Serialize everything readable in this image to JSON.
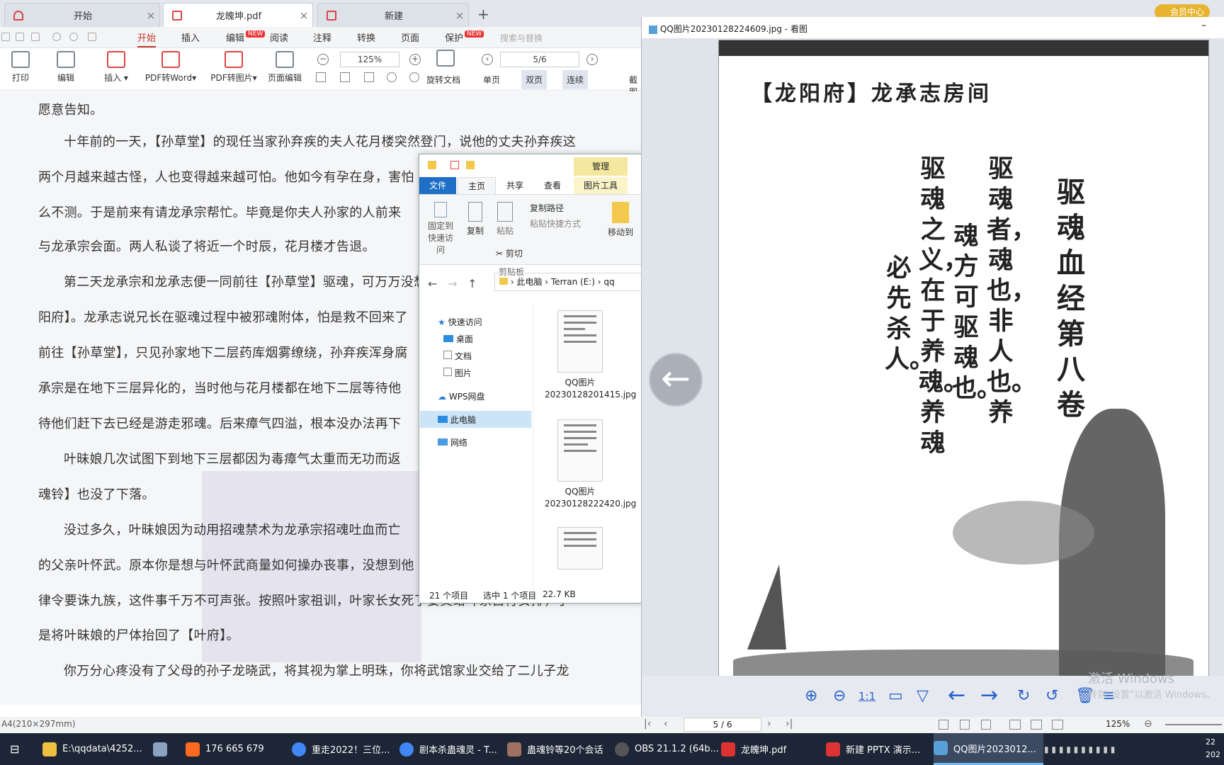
{
  "tabs": [
    {
      "label": "开始",
      "close": "×"
    },
    {
      "label": "龙魄坤.pdf",
      "close": "×"
    },
    {
      "label": "新建",
      "close": "×"
    }
  ],
  "new_tab": "+",
  "vip_label": "会员中心",
  "menu": [
    "开始",
    "插入",
    "编辑",
    "阅读",
    "注释",
    "转换",
    "页面",
    "保护"
  ],
  "new_badge": "NEW",
  "search_placeholder": "搜索与替换",
  "ribbon": {
    "print": "打印",
    "edit": "编辑",
    "insert": "插入",
    "pdf_to_word": "PDF转Word",
    "pdf_to_image": "PDF转图片",
    "page_edit": "页面编辑",
    "zoom": "125%",
    "page": "5/6",
    "rotate": "旋转文档",
    "single": "单页",
    "double": "双页",
    "continuous": "连续",
    "crop": "截图"
  },
  "document": {
    "lines": [
      "愿意告知。",
      "十年前的一天，【孙草堂】的现任当家孙弃疾的夫人花月楼突然登门，说他的丈夫孙弃疾这",
      "两个月越来越古怪，人也变得越来越可怕。他如今有孕在身，害怕",
      "么不测。于是前来有请龙承宗帮忙。毕竟是你夫人孙家的人前来",
      "与龙承宗会面。两人私谈了将近一个时辰，花月楼才告退。",
      "第二天龙承宗和龙承志便一同前往【孙草堂】驱魂，可万万没想",
      "阳府】。龙承志说兄长在驱魂过程中被邪魂附体，怕是救不回来了",
      "前往【孙草堂】，只见孙家地下二层药库烟雾缭绕，孙弃疾浑身腐",
      "承宗是在地下三层异化的，当时他与花月楼都在地下二层等待他",
      "待他们赶下去已经是游走邪魂。后来瘴气四溢，根本没办法再下",
      "叶昧娘几次试图下到地下三层都因为毒瘴气太重而无功而返",
      "魂铃】也没了下落。",
      "没过多久，叶昧娘因为动用招魂禁术为龙承宗招魂吐血而亡",
      "的父亲叶怀武。原本你是想与叶怀武商量如何操办丧事，没想到他",
      "律令要诛九族，这件事千万不可声张。按照叶家祖训，叶家长女死了要交给叶家自行安排，于",
      "是将叶昧娘的尸体抬回了【叶府】。",
      "你万分心疼没有了父母的孙子龙晓武，将其视为掌上明珠，你将武馆家业交给了二儿子龙"
    ],
    "page_size": "A4(210×297mm)"
  },
  "explorer": {
    "manage": "管理",
    "tabs": [
      "文件",
      "主页",
      "共享",
      "查看",
      "图片工具"
    ],
    "ribbon": {
      "pin": "固定到快速访问",
      "copy": "复制",
      "paste": "粘贴",
      "copy_path": "复制路径",
      "paste_shortcut": "粘贴快捷方式",
      "cut": "剪切",
      "clipboard": "剪贴板",
      "move_to": "移动到"
    },
    "breadcrumb": [
      "此电脑",
      "Terran (E:)",
      "qq"
    ],
    "nav": [
      "快速访问",
      "桌面",
      "文档",
      "图片",
      "WPS网盘",
      "此电脑",
      "网络"
    ],
    "files": [
      "QQ图片20230128201415.jpg",
      "QQ图片20230128222420.jpg"
    ],
    "status": {
      "count": "21 个项目",
      "selected": "选中 1 个项目",
      "size": "22.7 KB"
    }
  },
  "viewer": {
    "title": "QQ图片20230128224609.jpg - 看图",
    "minimize": "–",
    "header": "【龙阳府】龙承志房间",
    "columns": [
      "驱魂血经第八卷",
      "驱魂者，魂也，非人也。养",
      "魂方可驱魂也。",
      "驱魂之义，在于养魂。养魂",
      "必先杀人。"
    ],
    "tools": {
      "one_to_one": "1:1"
    },
    "activate_title": "激活 Windows",
    "activate_sub": "转到“设置”以激活 Windows。"
  },
  "pdf_nav": {
    "page": "5 / 6",
    "zoom": "125%"
  },
  "taskbar": [
    {
      "label": "E:\\qqdata\\4252...",
      "color": "#f0c040"
    },
    {
      "label": "",
      "color": "#8aa2c0"
    },
    {
      "label": "176 665 679",
      "color": "#ff6a20"
    },
    {
      "label": "重走2022！三位...",
      "color": "#4285f4"
    },
    {
      "label": "剧本杀蛊魂灵 - T...",
      "color": "#4285f4"
    },
    {
      "label": "蛊魂铃等20个会话",
      "color": "#a07060"
    },
    {
      "label": "OBS 21.1.2 (64b...",
      "color": "#555"
    },
    {
      "label": "龙魄坤.pdf",
      "color": "#d33"
    },
    {
      "label": "新建 PPTX 演示...",
      "color": "#d33"
    },
    {
      "label": "QQ图片2023012...",
      "color": "#5aa0d8"
    }
  ],
  "clock": {
    "time": "22",
    "date": "202"
  }
}
